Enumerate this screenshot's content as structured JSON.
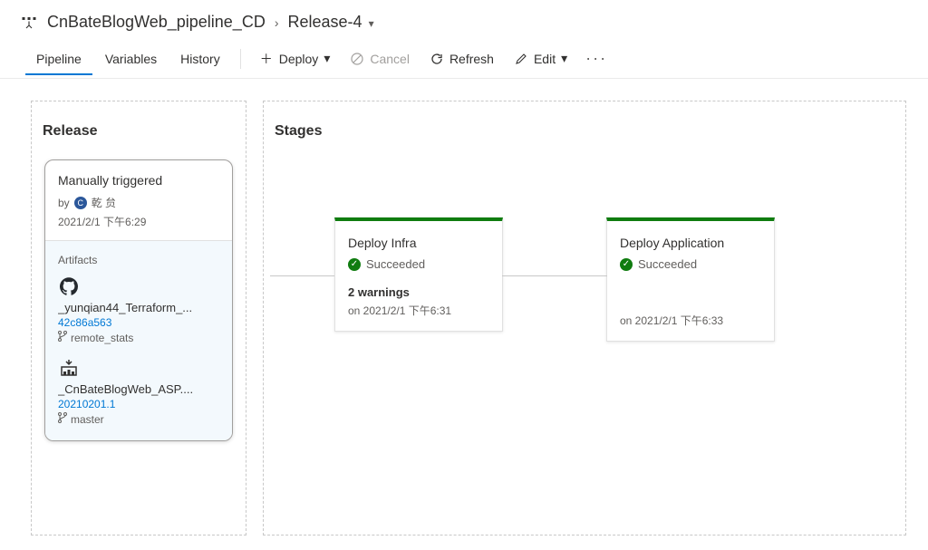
{
  "breadcrumb": {
    "pipeline": "CnBateBlogWeb_pipeline_CD",
    "release": "Release-4"
  },
  "tabs": {
    "pipeline": "Pipeline",
    "variables": "Variables",
    "history": "History"
  },
  "commands": {
    "deploy": "Deploy",
    "cancel": "Cancel",
    "refresh": "Refresh",
    "edit": "Edit"
  },
  "panels": {
    "release": "Release",
    "stages": "Stages"
  },
  "release": {
    "trigger": "Manually triggered",
    "by_prefix": "by",
    "user": "乾 贠",
    "avatar_initial": "C",
    "timestamp": "2021/2/1 下午6:29",
    "artifacts_header": "Artifacts",
    "artifacts": [
      {
        "name": "_yunqian44_Terraform_...",
        "version": "42c86a563",
        "branch": "remote_stats",
        "source": "github"
      },
      {
        "name": "_CnBateBlogWeb_ASP....",
        "version": "20210201.1",
        "branch": "master",
        "source": "azure"
      }
    ]
  },
  "stages": [
    {
      "name": "Deploy Infra",
      "status": "Succeeded",
      "warnings": "2 warnings",
      "time": "on 2021/2/1 下午6:31"
    },
    {
      "name": "Deploy Application",
      "status": "Succeeded",
      "warnings": "",
      "time": "on 2021/2/1 下午6:33"
    }
  ]
}
